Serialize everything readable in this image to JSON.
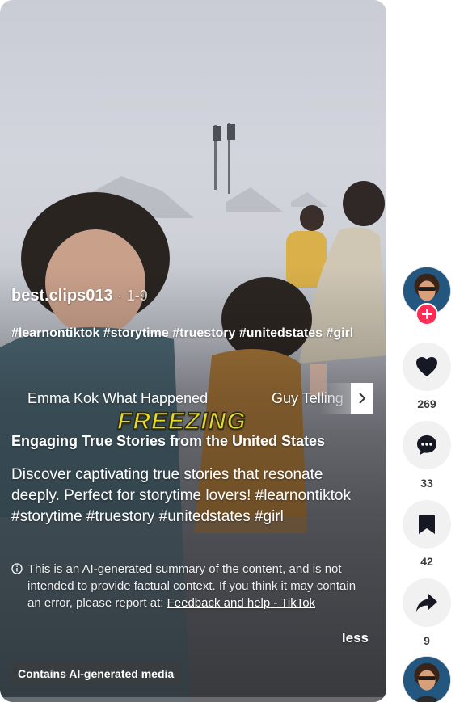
{
  "video": {
    "author": "best.clips013",
    "separator": "·",
    "date": "1-9",
    "hashtags": "#learnontiktok #storytime #truestory #unitedstates #girl",
    "chips": [
      "Emma Kok What Happened",
      "Guy Telling"
    ],
    "overlay_caption": "FREEZING",
    "summary_title": "Engaging True Stories from the United States",
    "summary_body": "Discover captivating true stories that resonate deeply. Perfect for storytime lovers! #learnontiktok #storytime #truestory #unitedstates #girl",
    "disclaimer_text": "This is an AI-generated summary of the content, and is not intended to provide factual context. If you think it may contain an error, please report at: ",
    "disclaimer_link": "Feedback and help - TikTok",
    "less_label": "less",
    "ai_badge": "Contains AI-generated media"
  },
  "actions": {
    "likes": "269",
    "comments": "33",
    "bookmarks": "42",
    "shares": "9"
  },
  "colors": {
    "follow_red": "#fe2c55",
    "caption_yellow": "#e6d92a",
    "action_bg": "#f1f1f2"
  },
  "icons": [
    "info-icon",
    "chevron-right-icon",
    "plus-icon",
    "heart-icon",
    "comment-icon",
    "bookmark-icon",
    "share-icon"
  ]
}
